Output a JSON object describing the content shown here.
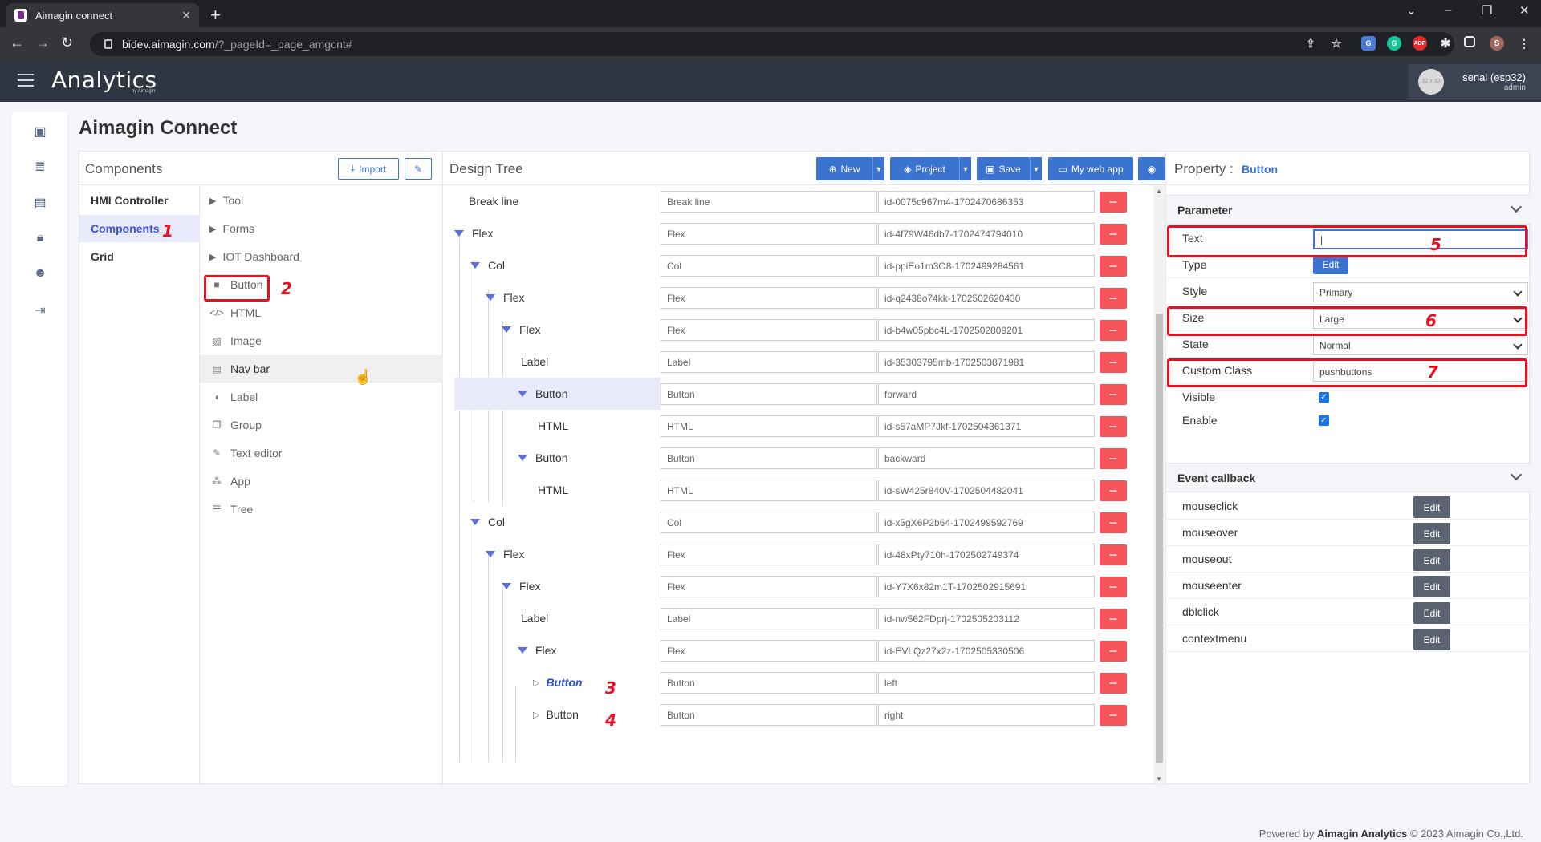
{
  "browser": {
    "tab_title": "Aimagin connect",
    "url_host": "bidev.aimagin.com",
    "url_path": "/?_pageId=_page_amgcnt#",
    "profile_initial": "S"
  },
  "header": {
    "logo": "Analytics",
    "logo_sub": "by Aimagin",
    "avatar_text": "32 x 32",
    "user_name": "senal (esp32)",
    "user_role": "admin"
  },
  "page": {
    "title": "Aimagin Connect"
  },
  "components": {
    "title": "Components",
    "import_label": "Import",
    "categories": [
      {
        "label": "HMI Controller"
      },
      {
        "label": "Components"
      },
      {
        "label": "Grid"
      }
    ],
    "groups": [
      {
        "label": "Tool"
      },
      {
        "label": "Forms"
      },
      {
        "label": "IOT Dashboard"
      }
    ],
    "items": [
      {
        "label": "Button",
        "icon": "square-icon"
      },
      {
        "label": "HTML",
        "icon": "code-icon"
      },
      {
        "label": "Image",
        "icon": "image-icon"
      },
      {
        "label": "Nav bar",
        "icon": "navbar-icon"
      },
      {
        "label": "Label",
        "icon": "tag-icon"
      },
      {
        "label": "Group",
        "icon": "group-icon"
      },
      {
        "label": "Text editor",
        "icon": "edit-icon"
      },
      {
        "label": "App",
        "icon": "sitemap-icon"
      },
      {
        "label": "Tree",
        "icon": "list-icon"
      }
    ]
  },
  "design_tree": {
    "title": "Design Tree",
    "toolbar": {
      "new": "New",
      "project": "Project",
      "save": "Save",
      "webapp": "My web app"
    },
    "rows": [
      {
        "name": "Break line",
        "type": "Break line",
        "id": "id-0075c967m4-1702470686353"
      },
      {
        "name": "Flex",
        "type": "Flex",
        "id": "id-4f79W46db7-1702474794010"
      },
      {
        "name": "Col",
        "type": "Col",
        "id": "id-ppiEo1m3O8-1702499284561"
      },
      {
        "name": "Flex",
        "type": "Flex",
        "id": "id-q2438o74kk-1702502620430"
      },
      {
        "name": "Flex",
        "type": "Flex",
        "id": "id-b4w05pbc4L-1702502809201"
      },
      {
        "name": "Label",
        "type": "Label",
        "id": "id-35303795mb-1702503871981"
      },
      {
        "name": "Button",
        "type": "Button",
        "id": "forward"
      },
      {
        "name": "HTML",
        "type": "HTML",
        "id": "id-s57aMP7Jkf-1702504361371"
      },
      {
        "name": "Button",
        "type": "Button",
        "id": "backward"
      },
      {
        "name": "HTML",
        "type": "HTML",
        "id": "id-sW425r840V-1702504482041"
      },
      {
        "name": "Col",
        "type": "Col",
        "id": "id-x5gX6P2b64-1702499592769"
      },
      {
        "name": "Flex",
        "type": "Flex",
        "id": "id-48xPty710h-1702502749374"
      },
      {
        "name": "Flex",
        "type": "Flex",
        "id": "id-Y7X6x82m1T-1702502915691"
      },
      {
        "name": "Label",
        "type": "Label",
        "id": "id-nw562FDprj-1702505203112"
      },
      {
        "name": "Flex",
        "type": "Flex",
        "id": "id-EVLQz27x2z-1702505330506"
      },
      {
        "name": "Button",
        "type": "Button",
        "id": "left"
      },
      {
        "name": "Button",
        "type": "Button",
        "id": "right"
      }
    ]
  },
  "property": {
    "title": "Property :",
    "target": "Button",
    "parameter_title": "Parameter",
    "params": {
      "text_label": "Text",
      "text_value": "|",
      "type_label": "Type",
      "type_btn": "Edit",
      "style_label": "Style",
      "style_value": "Primary",
      "size_label": "Size",
      "size_value": "Large",
      "state_label": "State",
      "state_value": "Normal",
      "class_label": "Custom Class",
      "class_value": "pushbuttons",
      "visible_label": "Visible",
      "enable_label": "Enable"
    },
    "event_title": "Event callback",
    "events": [
      {
        "label": "mouseclick",
        "btn": "Edit"
      },
      {
        "label": "mouseover",
        "btn": "Edit"
      },
      {
        "label": "mouseout",
        "btn": "Edit"
      },
      {
        "label": "mouseenter",
        "btn": "Edit"
      },
      {
        "label": "dblclick",
        "btn": "Edit"
      },
      {
        "label": "contextmenu",
        "btn": "Edit"
      }
    ]
  },
  "annotations": [
    "1",
    "2",
    "3",
    "4",
    "5",
    "6",
    "7"
  ],
  "footer": {
    "prefix": "Powered by",
    "brand": "Aimagin Analytics",
    "suffix": "© 2023 Aimagin Co.,Ltd."
  },
  "colors": {
    "accent": "#3b73d1",
    "delete": "#f5545a",
    "annotation": "#e8101f",
    "header": "#2f3542"
  }
}
